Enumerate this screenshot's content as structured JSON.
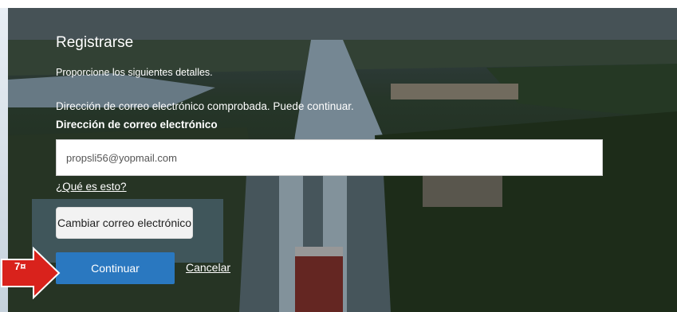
{
  "form": {
    "title": "Registrarse",
    "intro": "Proporcione los siguientes detalles.",
    "verified_message": "Dirección de correo electrónico comprobada. Puede continuar.",
    "email_label": "Dirección de correo electrónico",
    "email_value": "propsli56@yopmail.com",
    "whatis_link": "¿Qué es esto?",
    "change_email_label": "Cambiar correo electrónico",
    "continue_label": "Continuar",
    "cancel_label": "Cancelar"
  },
  "annotation": {
    "step_number": "7",
    "step_suffix": "¤",
    "color": "#d9221c"
  },
  "colors": {
    "primary_button": "#2a78c0",
    "secondary_button": "#f2f2f2"
  }
}
